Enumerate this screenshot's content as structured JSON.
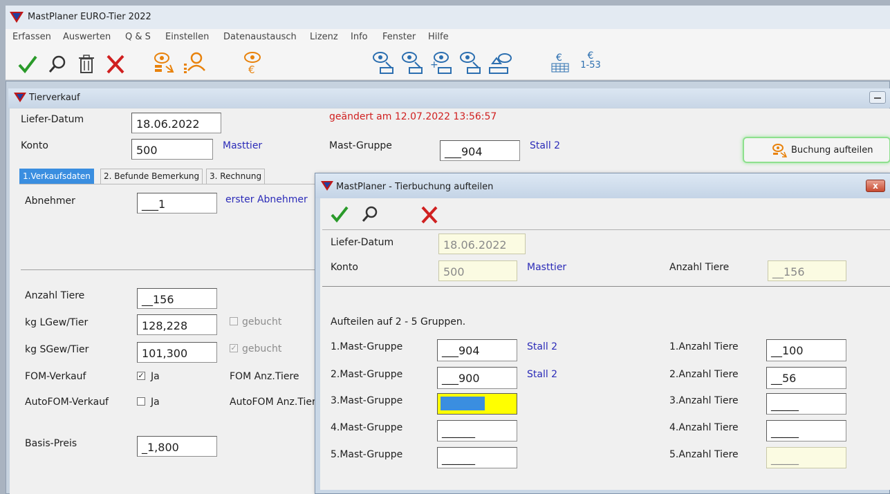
{
  "app": {
    "title": "MastPlaner EURO-Tier 2022",
    "menu": [
      "Erfassen",
      "Auswerten",
      "Q & S",
      "Einstellen",
      "Datenaustausch",
      "Lizenz",
      "Info",
      "Fenster",
      "Hilfe"
    ],
    "toolbar_text": {
      "euro1": "€",
      "euro2": "€",
      "euro2_sub": "1-53"
    }
  },
  "inner": {
    "title": "Tierverkauf",
    "liefer_datum_label": "Liefer-Datum",
    "liefer_datum": "18.06.2022",
    "konto_label": "Konto",
    "konto": "500",
    "konto_name": "Masttier",
    "changed_note": "geändert am 12.07.2022 13:56:57",
    "mast_gruppe_label": "Mast-Gruppe",
    "mast_gruppe": "___904",
    "stall": "Stall 2",
    "buchung_button": "Buchung aufteilen",
    "tabs": [
      "1.Verkaufsdaten",
      "2. Befunde Bemerkung",
      "3. Rechnung"
    ],
    "abnehmer_label": "Abnehmer",
    "abnehmer": "___1",
    "abnehmer_name": "erster Abnehmer",
    "anzahl_tiere_label": "Anzahl Tiere",
    "anzahl_tiere": "__156",
    "kg_lgew_label": "kg LGew/Tier",
    "kg_lgew": "128,228",
    "gebucht1": "gebucht",
    "kg_sgew_label": "kg SGew/Tier",
    "kg_sgew": "101,300",
    "gebucht2": "gebucht",
    "fom_label": "FOM-Verkauf",
    "fom_ja": "Ja",
    "fom_anz_label": "FOM Anz.Tiere",
    "autofom_label": "AutoFOM-Verkauf",
    "autofom_ja": "Ja",
    "autofom_anz_label": "AutoFOM Anz.Tier",
    "basis_preis_label": "Basis-Preis",
    "basis_preis": "_1,800"
  },
  "dialog": {
    "title": "MastPlaner - Tierbuchung aufteilen",
    "close": "x",
    "liefer_datum_label": "Liefer-Datum",
    "liefer_datum": "18.06.2022",
    "konto_label": "Konto",
    "konto": "500",
    "konto_name": "Masttier",
    "anzahl_tiere_label": "Anzahl Tiere",
    "anzahl_tiere": "__156",
    "aufteilen_note": "Aufteilen auf 2 - 5 Gruppen.",
    "groups": [
      {
        "label": "1.Mast-Gruppe",
        "value": "___904",
        "stall": "Stall 2",
        "anz_label": "1.Anzahl Tiere",
        "anz": "__100"
      },
      {
        "label": "2.Mast-Gruppe",
        "value": "___900",
        "stall": "Stall 2",
        "anz_label": "2.Anzahl Tiere",
        "anz": "__56"
      },
      {
        "label": "3.Mast-Gruppe",
        "value": "",
        "stall": "",
        "anz_label": "3.Anzahl Tiere",
        "anz": "_____"
      },
      {
        "label": "4.Mast-Gruppe",
        "value": "______",
        "stall": "",
        "anz_label": "4.Anzahl Tiere",
        "anz": "_____"
      },
      {
        "label": "5.Mast-Gruppe",
        "value": "______",
        "stall": "",
        "anz_label": "5.Anzahl Tiere",
        "anz": "_____"
      }
    ]
  },
  "colors": {
    "accent_red": "#d02020",
    "check_green": "#2a9a2a",
    "link_blue": "#2b2bb8",
    "icon_orange": "#e8820c",
    "icon_blue": "#2c6fb0"
  }
}
